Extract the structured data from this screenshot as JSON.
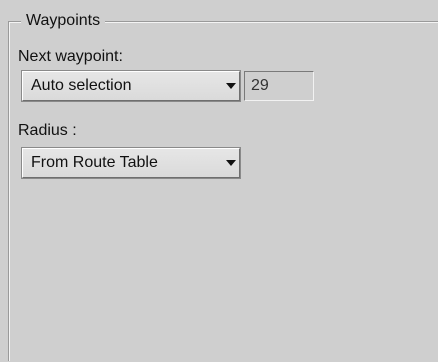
{
  "group": {
    "title": "Waypoints"
  },
  "next_waypoint": {
    "label": "Next waypoint:",
    "selected": "Auto selection",
    "number": "29"
  },
  "radius": {
    "label": "Radius :",
    "selected": "From Route Table"
  },
  "icons": {
    "dropdown": "chevron-down-icon"
  }
}
